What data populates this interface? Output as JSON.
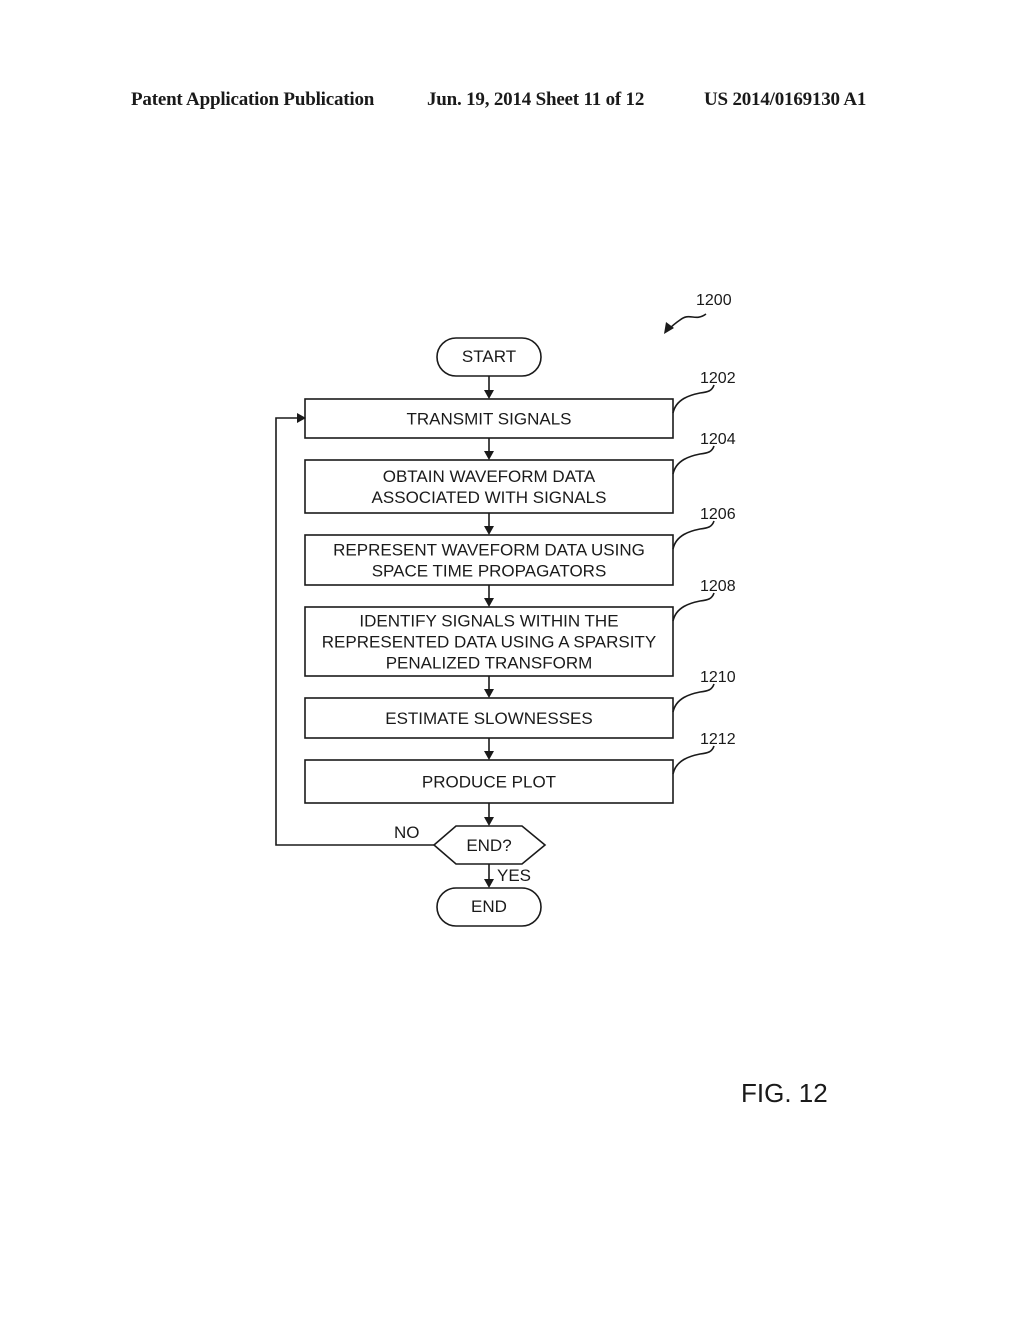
{
  "header": {
    "publication": "Patent Application Publication",
    "date_sheet": "Jun. 19, 2014  Sheet 11 of 12",
    "number": "US 2014/0169130 A1"
  },
  "diagram": {
    "ref": "1200",
    "start": "START",
    "steps": [
      {
        "ref": "1202",
        "lines": [
          "TRANSMIT SIGNALS"
        ]
      },
      {
        "ref": "1204",
        "lines": [
          "OBTAIN WAVEFORM DATA",
          "ASSOCIATED WITH SIGNALS"
        ]
      },
      {
        "ref": "1206",
        "lines": [
          "REPRESENT WAVEFORM DATA USING",
          "SPACE TIME PROPAGATORS"
        ]
      },
      {
        "ref": "1208",
        "lines": [
          "IDENTIFY SIGNALS WITHIN THE",
          "REPRESENTED DATA USING A SPARSITY",
          "PENALIZED TRANSFORM"
        ]
      },
      {
        "ref": "1210",
        "lines": [
          "ESTIMATE SLOWNESSES"
        ]
      },
      {
        "ref": "1212",
        "lines": [
          "PRODUCE PLOT"
        ]
      }
    ],
    "decision": "END?",
    "no_label": "NO",
    "yes_label": "YES",
    "end": "END"
  },
  "figure_label": "FIG. 12"
}
